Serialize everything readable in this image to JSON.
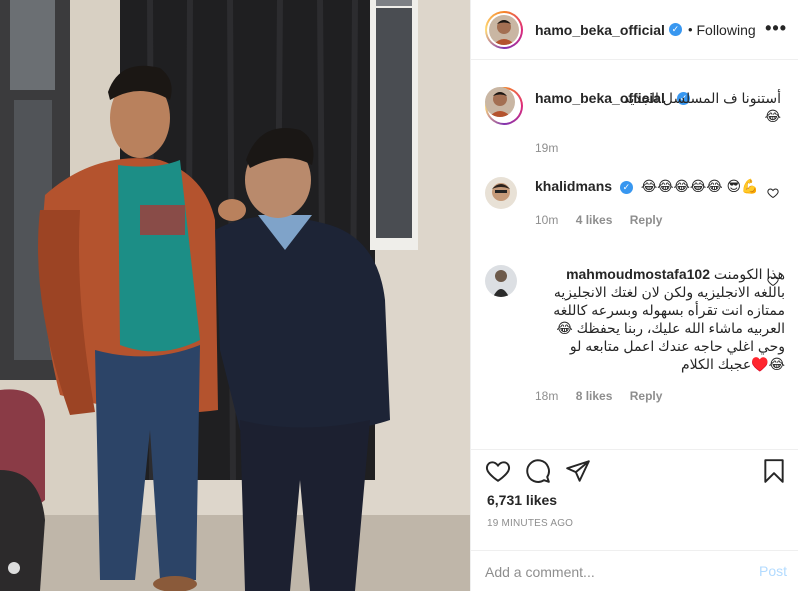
{
  "post": {
    "author": "hamo_beka_official",
    "follow_status": "Following",
    "dot": "•",
    "more": "•••",
    "verified_mark": "✓",
    "accent": "#3897f0"
  },
  "caption": {
    "username": "hamo_beka_official",
    "text": "أستنونا ف المسلسل الجديد 😂",
    "time": "19m"
  },
  "comments": [
    {
      "username": "khalidmans",
      "text": "😂😂😂😂😂 😎💪",
      "time": "10m",
      "likes": "4 likes",
      "reply": "Reply"
    },
    {
      "username": "mahmoudmostafa102",
      "text": "هذا الكومنت باللغه الانجليزيه ولكن لان لغتك الانجليزيه ممتازه انت تقرأه بسهوله وبسرعه كاللغه العربيه ماشاء الله عليك، ربنا يحفظك 😂 وحي اغلي حاجه عندك اعمل متابعه لو عجبك الكلام♥️😂",
      "time": "18m",
      "likes": "8 likes",
      "reply": "Reply"
    }
  ],
  "icons": {
    "like": "heart-icon",
    "comment": "comment-icon",
    "share": "share-icon",
    "save": "bookmark-icon"
  },
  "likes_count": "6,731 likes",
  "posted": "19 MINUTES AGO",
  "add_comment": {
    "placeholder": "Add a comment...",
    "post_label": "Post"
  }
}
